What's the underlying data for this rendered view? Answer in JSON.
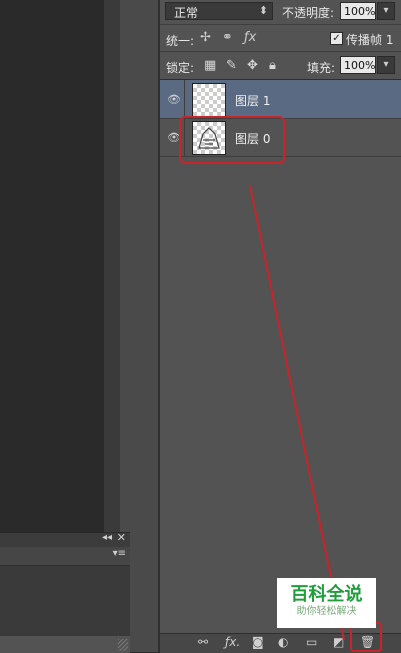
{
  "layers_panel": {
    "blend_mode": "正常",
    "opacity_label": "不透明度:",
    "opacity_value": "100%",
    "unify_label": "统一:",
    "propagate_label": "传播帧 1",
    "propagate_checked": true,
    "lock_label": "锁定:",
    "fill_label": "填充:",
    "fill_value": "100%",
    "layers": [
      {
        "name": "图层 1",
        "selected": true,
        "visible": true
      },
      {
        "name": "图层 0",
        "selected": false,
        "visible": true
      }
    ],
    "selected_color": "#5a6a82"
  },
  "annotation": {
    "color": "#c8242a"
  },
  "watermark": {
    "title": "百科全说",
    "subtitle": "助你轻松解决"
  }
}
